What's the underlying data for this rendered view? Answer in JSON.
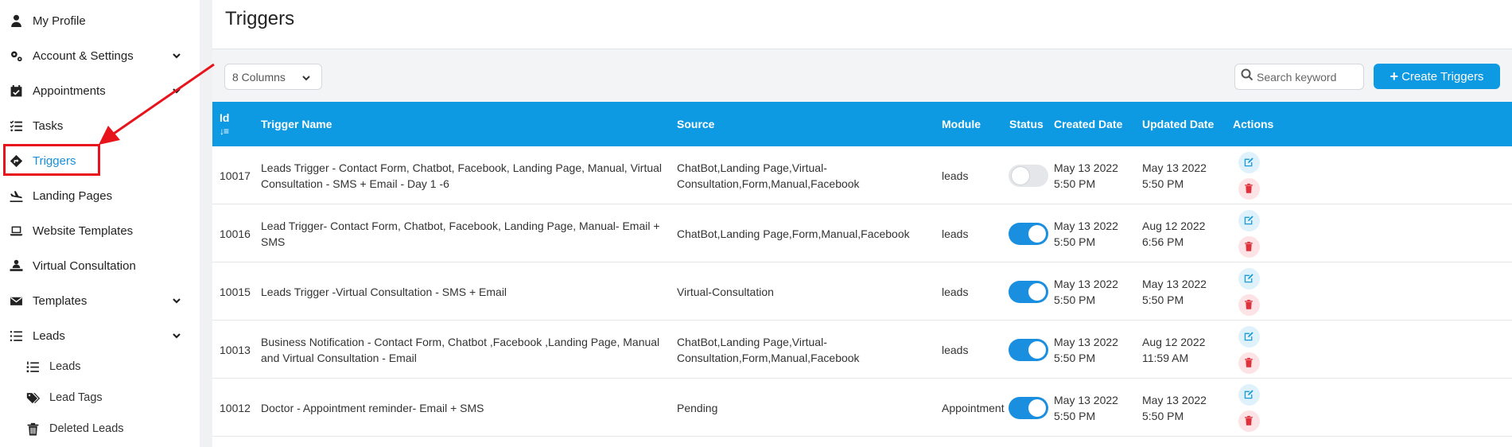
{
  "sidebar": {
    "items": [
      {
        "label": "My Profile",
        "icon": "user-doctor-icon",
        "chevron": false
      },
      {
        "label": "Account & Settings",
        "icon": "gears-icon",
        "chevron": true
      },
      {
        "label": "Appointments",
        "icon": "calendar-check-icon",
        "chevron": true
      },
      {
        "label": "Tasks",
        "icon": "checklist-icon",
        "chevron": false
      },
      {
        "label": "Triggers",
        "icon": "trigger-diamond-icon",
        "chevron": false,
        "active": true
      },
      {
        "label": "Landing Pages",
        "icon": "plane-landing-icon",
        "chevron": false
      },
      {
        "label": "Website Templates",
        "icon": "laptop-icon",
        "chevron": false
      },
      {
        "label": "Virtual Consultation",
        "icon": "user-laptop-icon",
        "chevron": false
      },
      {
        "label": "Templates",
        "icon": "envelope-icon",
        "chevron": true
      },
      {
        "label": "Leads",
        "icon": "list-icon",
        "chevron": true
      }
    ],
    "subitems": [
      {
        "label": "Leads",
        "icon": "list-ol-icon"
      },
      {
        "label": "Lead Tags",
        "icon": "tags-icon"
      },
      {
        "label": "Deleted Leads",
        "icon": "trash-icon"
      }
    ]
  },
  "page": {
    "title": "Triggers"
  },
  "toolbar": {
    "columns_label": "8 Columns",
    "search_placeholder": "Search keyword",
    "create_label": "Create Triggers"
  },
  "table": {
    "headers": {
      "id": "Id",
      "name": "Trigger Name",
      "source": "Source",
      "module": "Module",
      "status": "Status",
      "created": "Created Date",
      "updated": "Updated Date",
      "actions": "Actions"
    },
    "rows": [
      {
        "id": "10017",
        "name": "Leads Trigger - Contact Form, Chatbot, Facebook, Landing Page, Manual, Virtual Consultation - SMS + Email - Day 1 -6",
        "source": "ChatBot,Landing Page,Virtual-Consultation,Form,Manual,Facebook",
        "module": "leads",
        "status": "off",
        "created": "May 13 2022 5:50 PM",
        "updated": "May 13 2022 5:50 PM"
      },
      {
        "id": "10016",
        "name": "Lead Trigger- Contact Form, Chatbot, Facebook, Landing Page, Manual- Email + SMS",
        "source": "ChatBot,Landing Page,Form,Manual,Facebook",
        "module": "leads",
        "status": "on",
        "created": "May 13 2022 5:50 PM",
        "updated": "Aug 12 2022 6:56 PM"
      },
      {
        "id": "10015",
        "name": "Leads Trigger -Virtual Consultation - SMS + Email",
        "source": "Virtual-Consultation",
        "module": "leads",
        "status": "on",
        "created": "May 13 2022 5:50 PM",
        "updated": "May 13 2022 5:50 PM"
      },
      {
        "id": "10013",
        "name": "Business Notification - Contact Form, Chatbot ,Facebook ,Landing Page, Manual and Virtual Consultation - Email",
        "source": "ChatBot,Landing Page,Virtual-Consultation,Form,Manual,Facebook",
        "module": "leads",
        "status": "on",
        "created": "May 13 2022 5:50 PM",
        "updated": "Aug 12 2022 11:59 AM"
      },
      {
        "id": "10012",
        "name": "Doctor - Appointment reminder- Email + SMS",
        "source": "Pending",
        "module": "Appointment",
        "status": "on",
        "created": "May 13 2022 5:50 PM",
        "updated": "May 13 2022 5:50 PM"
      }
    ]
  },
  "colors": {
    "accent": "#0e9ae3",
    "toggle_on": "#1a8fe0",
    "annotation": "#e8141b"
  }
}
